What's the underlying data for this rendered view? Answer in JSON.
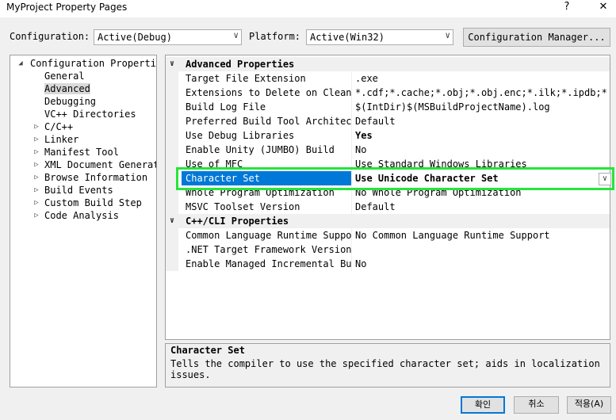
{
  "window": {
    "title": "MyProject Property Pages",
    "help_label": "?",
    "close_label": "✕"
  },
  "config_bar": {
    "configuration_label": "Configuration:",
    "configuration_value": "Active(Debug)",
    "platform_label": "Platform:",
    "platform_value": "Active(Win32)",
    "manager_button": "Configuration Manager..."
  },
  "tree": {
    "items": [
      {
        "label": "Configuration Properties",
        "expander": "◢",
        "state": "expanded"
      },
      {
        "label": "General"
      },
      {
        "label": "Advanced",
        "selected": true
      },
      {
        "label": "Debugging"
      },
      {
        "label": "VC++ Directories"
      },
      {
        "label": "C/C++",
        "expander": "▷"
      },
      {
        "label": "Linker",
        "expander": "▷"
      },
      {
        "label": "Manifest Tool",
        "expander": "▷"
      },
      {
        "label": "XML Document Generator",
        "expander": "▷"
      },
      {
        "label": "Browse Information",
        "expander": "▷"
      },
      {
        "label": "Build Events",
        "expander": "▷"
      },
      {
        "label": "Custom Build Step",
        "expander": "▷"
      },
      {
        "label": "Code Analysis",
        "expander": "▷"
      }
    ]
  },
  "grid": {
    "rows": [
      {
        "type": "category",
        "toggle": "∨",
        "name": "Advanced Properties"
      },
      {
        "name": "Target File Extension",
        "value": ".exe"
      },
      {
        "name": "Extensions to Delete on Clean",
        "value": "*.cdf;*.cache;*.obj;*.obj.enc;*.ilk;*.ipdb;*.i"
      },
      {
        "name": "Build Log File",
        "value": "$(IntDir)$(MSBuildProjectName).log"
      },
      {
        "name": "Preferred Build Tool Architecture",
        "value": "Default"
      },
      {
        "name": "Use Debug Libraries",
        "value": "Yes",
        "bold": true
      },
      {
        "name": "Enable Unity (JUMBO) Build",
        "value": "No"
      },
      {
        "name": "Use of MFC",
        "value": "Use Standard Windows Libraries"
      },
      {
        "name": "Character Set",
        "value": "Use Unicode Character Set",
        "bold": true,
        "selected": true
      },
      {
        "name": "Whole Program Optimization",
        "value": "No Whole Program Optimization"
      },
      {
        "name": "MSVC Toolset Version",
        "value": "Default"
      },
      {
        "type": "category",
        "toggle": "∨",
        "name": "C++/CLI Properties"
      },
      {
        "name": "Common Language Runtime Support",
        "value": "No Common Language Runtime Support"
      },
      {
        "name": ".NET Target Framework Version",
        "value": ""
      },
      {
        "name": "Enable Managed Incremental Build",
        "value": "No"
      }
    ],
    "dropdown_chevron": "∨"
  },
  "description": {
    "title": "Character Set",
    "text": "Tells the compiler to use the specified character set; aids in localization issues."
  },
  "footer": {
    "ok": "확인",
    "cancel": "취소",
    "apply": "적용(A)"
  },
  "colors": {
    "selection": "#0078d7",
    "highlight_box": "#26e53a"
  }
}
